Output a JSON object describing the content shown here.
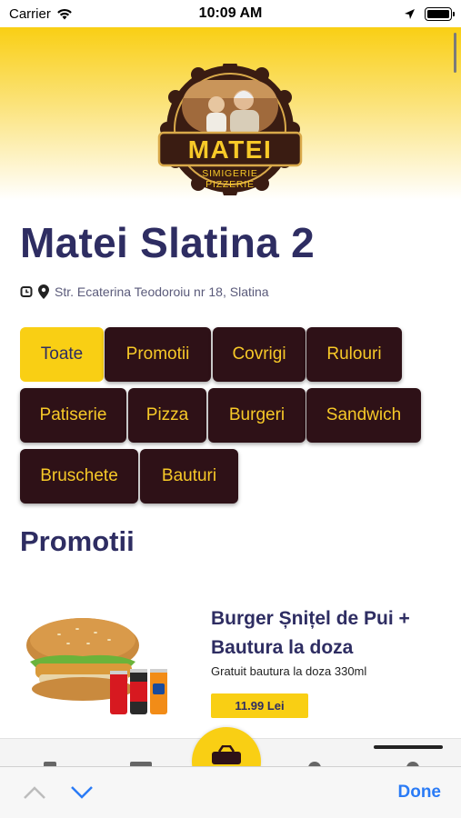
{
  "status_bar": {
    "carrier": "Carrier",
    "time": "10:09 AM"
  },
  "header": {
    "logo_text": "MATEI",
    "logo_sub1": "SIMIGERIE",
    "logo_sub2": "PIZZERIE"
  },
  "store": {
    "title": "Matei Slatina 2",
    "address": "Str. Ecaterina Teodoroiu nr 18, Slatina"
  },
  "categories": [
    {
      "label": "Toate",
      "active": true
    },
    {
      "label": "Promotii"
    },
    {
      "label": "Covrigi"
    },
    {
      "label": "Rulouri"
    },
    {
      "label": "Patiserie"
    },
    {
      "label": "Pizza"
    },
    {
      "label": "Burgeri"
    },
    {
      "label": "Sandwich"
    },
    {
      "label": "Bruschete"
    },
    {
      "label": "Bauturi"
    }
  ],
  "section": {
    "title": "Promotii"
  },
  "product": {
    "name": "Burger Șnițel de Pui + Bautura la doza",
    "description": "Gratuit bautura la doza 330ml",
    "price": "11.99 Lei"
  },
  "toolbar": {
    "done_label": "Done"
  },
  "colors": {
    "brand_yellow": "#f9cf14",
    "brand_brown": "#2e1117",
    "text_navy": "#2e2d62",
    "ios_blue": "#2a7bf6"
  }
}
